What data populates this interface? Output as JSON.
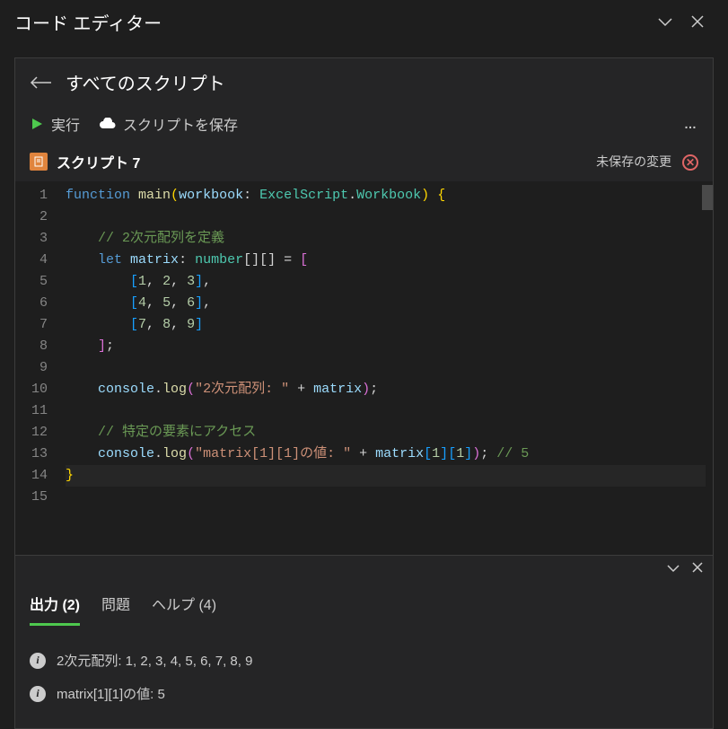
{
  "title": "コード エディター",
  "nav": {
    "all_scripts": "すべてのスクリプト"
  },
  "toolbar": {
    "run": "実行",
    "save": "スクリプトを保存",
    "more": "…"
  },
  "script": {
    "name": "スクリプト 7",
    "unsaved_label": "未保存の変更"
  },
  "code": {
    "lines": [
      [
        {
          "t": "function",
          "c": "tok-keyword"
        },
        {
          "t": " ",
          "c": ""
        },
        {
          "t": "main",
          "c": "tok-func"
        },
        {
          "t": "(",
          "c": "tok-brace-y"
        },
        {
          "t": "workbook",
          "c": "tok-ident"
        },
        {
          "t": ": ",
          "c": "tok-punct"
        },
        {
          "t": "ExcelScript",
          "c": "tok-type"
        },
        {
          "t": ".",
          "c": "tok-punct"
        },
        {
          "t": "Workbook",
          "c": "tok-type"
        },
        {
          "t": ")",
          "c": "tok-brace-y"
        },
        {
          "t": " ",
          "c": ""
        },
        {
          "t": "{",
          "c": "tok-brace-y"
        }
      ],
      [],
      [
        {
          "t": "    ",
          "c": ""
        },
        {
          "t": "// 2次元配列を定義",
          "c": "tok-comment"
        }
      ],
      [
        {
          "t": "    ",
          "c": ""
        },
        {
          "t": "let",
          "c": "tok-keyword"
        },
        {
          "t": " ",
          "c": ""
        },
        {
          "t": "matrix",
          "c": "tok-ident"
        },
        {
          "t": ": ",
          "c": "tok-punct"
        },
        {
          "t": "number",
          "c": "tok-type"
        },
        {
          "t": "[][]",
          "c": "tok-punct"
        },
        {
          "t": " = ",
          "c": "tok-punct"
        },
        {
          "t": "[",
          "c": "tok-brace-p"
        }
      ],
      [
        {
          "t": "        ",
          "c": ""
        },
        {
          "t": "[",
          "c": "tok-brace-b"
        },
        {
          "t": "1",
          "c": "tok-number"
        },
        {
          "t": ", ",
          "c": "tok-punct"
        },
        {
          "t": "2",
          "c": "tok-number"
        },
        {
          "t": ", ",
          "c": "tok-punct"
        },
        {
          "t": "3",
          "c": "tok-number"
        },
        {
          "t": "]",
          "c": "tok-brace-b"
        },
        {
          "t": ",",
          "c": "tok-punct"
        }
      ],
      [
        {
          "t": "        ",
          "c": ""
        },
        {
          "t": "[",
          "c": "tok-brace-b"
        },
        {
          "t": "4",
          "c": "tok-number"
        },
        {
          "t": ", ",
          "c": "tok-punct"
        },
        {
          "t": "5",
          "c": "tok-number"
        },
        {
          "t": ", ",
          "c": "tok-punct"
        },
        {
          "t": "6",
          "c": "tok-number"
        },
        {
          "t": "]",
          "c": "tok-brace-b"
        },
        {
          "t": ",",
          "c": "tok-punct"
        }
      ],
      [
        {
          "t": "        ",
          "c": ""
        },
        {
          "t": "[",
          "c": "tok-brace-b"
        },
        {
          "t": "7",
          "c": "tok-number"
        },
        {
          "t": ", ",
          "c": "tok-punct"
        },
        {
          "t": "8",
          "c": "tok-number"
        },
        {
          "t": ", ",
          "c": "tok-punct"
        },
        {
          "t": "9",
          "c": "tok-number"
        },
        {
          "t": "]",
          "c": "tok-brace-b"
        }
      ],
      [
        {
          "t": "    ",
          "c": ""
        },
        {
          "t": "]",
          "c": "tok-brace-p"
        },
        {
          "t": ";",
          "c": "tok-punct"
        }
      ],
      [],
      [
        {
          "t": "    ",
          "c": ""
        },
        {
          "t": "console",
          "c": "tok-ident"
        },
        {
          "t": ".",
          "c": "tok-punct"
        },
        {
          "t": "log",
          "c": "tok-func"
        },
        {
          "t": "(",
          "c": "tok-brace-p"
        },
        {
          "t": "\"2次元配列: \"",
          "c": "tok-string"
        },
        {
          "t": " + ",
          "c": "tok-punct"
        },
        {
          "t": "matrix",
          "c": "tok-ident"
        },
        {
          "t": ")",
          "c": "tok-brace-p"
        },
        {
          "t": ";",
          "c": "tok-punct"
        }
      ],
      [],
      [
        {
          "t": "    ",
          "c": ""
        },
        {
          "t": "// 特定の要素にアクセス",
          "c": "tok-comment"
        }
      ],
      [
        {
          "t": "    ",
          "c": ""
        },
        {
          "t": "console",
          "c": "tok-ident"
        },
        {
          "t": ".",
          "c": "tok-punct"
        },
        {
          "t": "log",
          "c": "tok-func"
        },
        {
          "t": "(",
          "c": "tok-brace-p"
        },
        {
          "t": "\"matrix[1][1]の値: \"",
          "c": "tok-string"
        },
        {
          "t": " + ",
          "c": "tok-punct"
        },
        {
          "t": "matrix",
          "c": "tok-ident"
        },
        {
          "t": "[",
          "c": "tok-brace-b"
        },
        {
          "t": "1",
          "c": "tok-number"
        },
        {
          "t": "]",
          "c": "tok-brace-b"
        },
        {
          "t": "[",
          "c": "tok-brace-b"
        },
        {
          "t": "1",
          "c": "tok-number"
        },
        {
          "t": "]",
          "c": "tok-brace-b"
        },
        {
          "t": ")",
          "c": "tok-brace-p"
        },
        {
          "t": ";",
          "c": "tok-punct"
        },
        {
          "t": " ",
          "c": ""
        },
        {
          "t": "// 5",
          "c": "tok-comment"
        }
      ],
      [
        {
          "t": "}",
          "c": "tok-brace-y"
        }
      ],
      []
    ],
    "current_line": 14,
    "line_count": 15
  },
  "output": {
    "tabs": {
      "output": "出力 (2)",
      "problems": "問題",
      "help": "ヘルプ (4)"
    },
    "lines": [
      "2次元配列:  1, 2, 3, 4, 5, 6, 7, 8, 9",
      "matrix[1][1]の値:  5"
    ]
  }
}
